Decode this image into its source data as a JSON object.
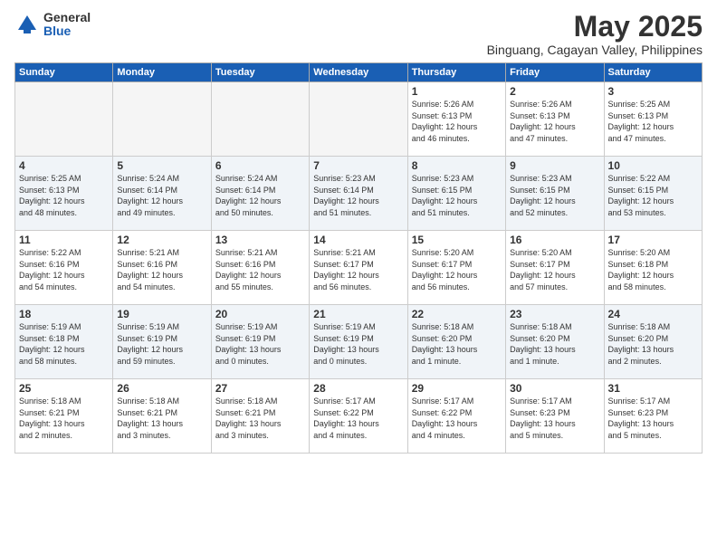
{
  "logo": {
    "general": "General",
    "blue": "Blue"
  },
  "title": "May 2025",
  "subtitle": "Binguang, Cagayan Valley, Philippines",
  "weekdays": [
    "Sunday",
    "Monday",
    "Tuesday",
    "Wednesday",
    "Thursday",
    "Friday",
    "Saturday"
  ],
  "weeks": [
    [
      {
        "day": "",
        "info": ""
      },
      {
        "day": "",
        "info": ""
      },
      {
        "day": "",
        "info": ""
      },
      {
        "day": "",
        "info": ""
      },
      {
        "day": "1",
        "info": "Sunrise: 5:26 AM\nSunset: 6:13 PM\nDaylight: 12 hours\nand 46 minutes."
      },
      {
        "day": "2",
        "info": "Sunrise: 5:26 AM\nSunset: 6:13 PM\nDaylight: 12 hours\nand 47 minutes."
      },
      {
        "day": "3",
        "info": "Sunrise: 5:25 AM\nSunset: 6:13 PM\nDaylight: 12 hours\nand 47 minutes."
      }
    ],
    [
      {
        "day": "4",
        "info": "Sunrise: 5:25 AM\nSunset: 6:13 PM\nDaylight: 12 hours\nand 48 minutes."
      },
      {
        "day": "5",
        "info": "Sunrise: 5:24 AM\nSunset: 6:14 PM\nDaylight: 12 hours\nand 49 minutes."
      },
      {
        "day": "6",
        "info": "Sunrise: 5:24 AM\nSunset: 6:14 PM\nDaylight: 12 hours\nand 50 minutes."
      },
      {
        "day": "7",
        "info": "Sunrise: 5:23 AM\nSunset: 6:14 PM\nDaylight: 12 hours\nand 51 minutes."
      },
      {
        "day": "8",
        "info": "Sunrise: 5:23 AM\nSunset: 6:15 PM\nDaylight: 12 hours\nand 51 minutes."
      },
      {
        "day": "9",
        "info": "Sunrise: 5:23 AM\nSunset: 6:15 PM\nDaylight: 12 hours\nand 52 minutes."
      },
      {
        "day": "10",
        "info": "Sunrise: 5:22 AM\nSunset: 6:15 PM\nDaylight: 12 hours\nand 53 minutes."
      }
    ],
    [
      {
        "day": "11",
        "info": "Sunrise: 5:22 AM\nSunset: 6:16 PM\nDaylight: 12 hours\nand 54 minutes."
      },
      {
        "day": "12",
        "info": "Sunrise: 5:21 AM\nSunset: 6:16 PM\nDaylight: 12 hours\nand 54 minutes."
      },
      {
        "day": "13",
        "info": "Sunrise: 5:21 AM\nSunset: 6:16 PM\nDaylight: 12 hours\nand 55 minutes."
      },
      {
        "day": "14",
        "info": "Sunrise: 5:21 AM\nSunset: 6:17 PM\nDaylight: 12 hours\nand 56 minutes."
      },
      {
        "day": "15",
        "info": "Sunrise: 5:20 AM\nSunset: 6:17 PM\nDaylight: 12 hours\nand 56 minutes."
      },
      {
        "day": "16",
        "info": "Sunrise: 5:20 AM\nSunset: 6:17 PM\nDaylight: 12 hours\nand 57 minutes."
      },
      {
        "day": "17",
        "info": "Sunrise: 5:20 AM\nSunset: 6:18 PM\nDaylight: 12 hours\nand 58 minutes."
      }
    ],
    [
      {
        "day": "18",
        "info": "Sunrise: 5:19 AM\nSunset: 6:18 PM\nDaylight: 12 hours\nand 58 minutes."
      },
      {
        "day": "19",
        "info": "Sunrise: 5:19 AM\nSunset: 6:19 PM\nDaylight: 12 hours\nand 59 minutes."
      },
      {
        "day": "20",
        "info": "Sunrise: 5:19 AM\nSunset: 6:19 PM\nDaylight: 13 hours\nand 0 minutes."
      },
      {
        "day": "21",
        "info": "Sunrise: 5:19 AM\nSunset: 6:19 PM\nDaylight: 13 hours\nand 0 minutes."
      },
      {
        "day": "22",
        "info": "Sunrise: 5:18 AM\nSunset: 6:20 PM\nDaylight: 13 hours\nand 1 minute."
      },
      {
        "day": "23",
        "info": "Sunrise: 5:18 AM\nSunset: 6:20 PM\nDaylight: 13 hours\nand 1 minute."
      },
      {
        "day": "24",
        "info": "Sunrise: 5:18 AM\nSunset: 6:20 PM\nDaylight: 13 hours\nand 2 minutes."
      }
    ],
    [
      {
        "day": "25",
        "info": "Sunrise: 5:18 AM\nSunset: 6:21 PM\nDaylight: 13 hours\nand 2 minutes."
      },
      {
        "day": "26",
        "info": "Sunrise: 5:18 AM\nSunset: 6:21 PM\nDaylight: 13 hours\nand 3 minutes."
      },
      {
        "day": "27",
        "info": "Sunrise: 5:18 AM\nSunset: 6:21 PM\nDaylight: 13 hours\nand 3 minutes."
      },
      {
        "day": "28",
        "info": "Sunrise: 5:17 AM\nSunset: 6:22 PM\nDaylight: 13 hours\nand 4 minutes."
      },
      {
        "day": "29",
        "info": "Sunrise: 5:17 AM\nSunset: 6:22 PM\nDaylight: 13 hours\nand 4 minutes."
      },
      {
        "day": "30",
        "info": "Sunrise: 5:17 AM\nSunset: 6:23 PM\nDaylight: 13 hours\nand 5 minutes."
      },
      {
        "day": "31",
        "info": "Sunrise: 5:17 AM\nSunset: 6:23 PM\nDaylight: 13 hours\nand 5 minutes."
      }
    ]
  ]
}
